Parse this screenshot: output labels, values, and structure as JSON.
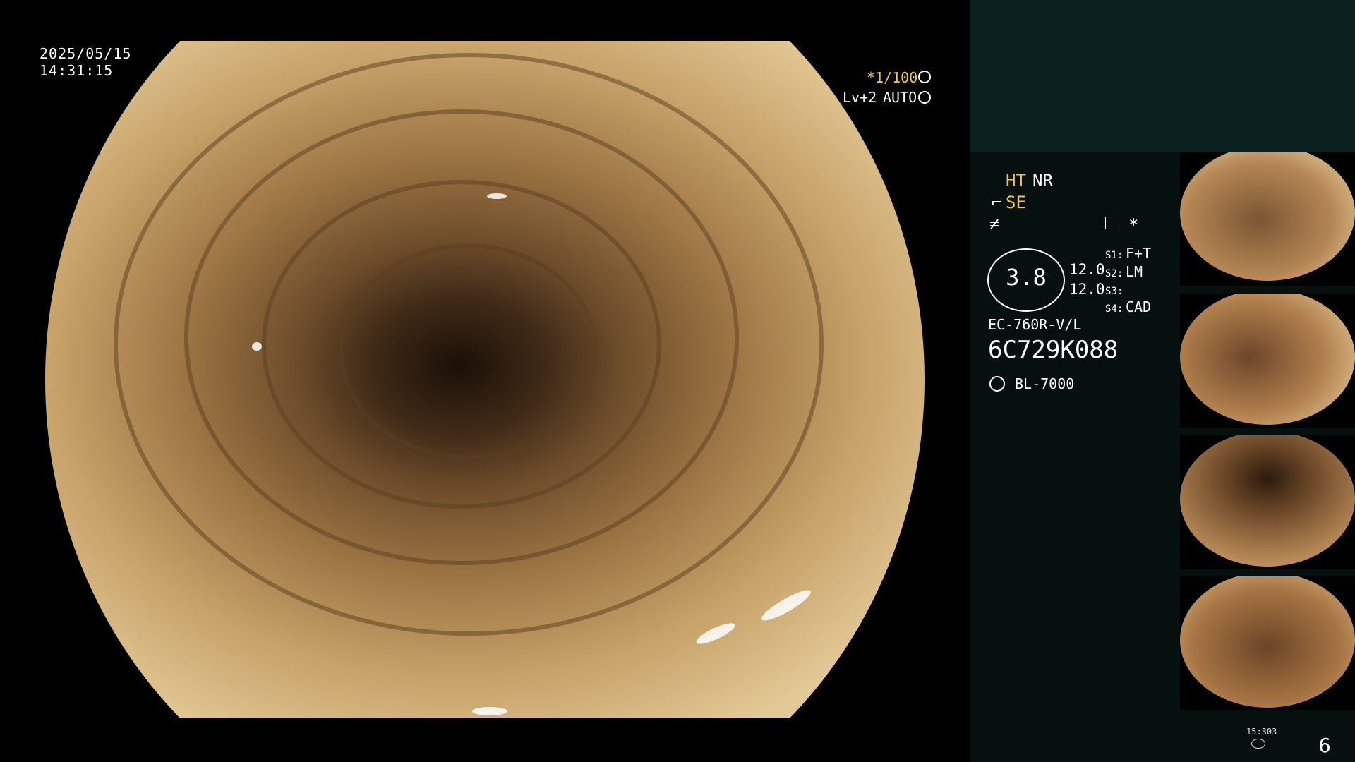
{
  "overlay": {
    "date": "2025/05/15",
    "time": "14:31:15",
    "shutter": "*1/100",
    "light_level": "Lv+2",
    "mode": "AUTO"
  },
  "settings": {
    "ht": "HT",
    "nr": "NR",
    "se": "SE",
    "gauge_value": "3.8",
    "value_1": "12.0",
    "value_2": "12.0",
    "s1_label": "S1:",
    "s1_value": "F+T",
    "s2_label": "S2:",
    "s2_value": "LM",
    "s3_label": "S3:",
    "s3_value": "",
    "s4_label": "S4:",
    "s4_value": "CAD",
    "scope_model": "EC-760R-V/L",
    "serial": "6C729K088",
    "light_source": "BL-7000"
  },
  "status": {
    "time": "15:303",
    "count": "6"
  },
  "colors": {
    "accent_yellow": "#f3c63c",
    "panel_bg": "#06100e",
    "panel_top_bg": "#0b211f"
  },
  "icons": [
    "aperture-icon",
    "auto-iris-icon",
    "structure-enhance-icon",
    "color-icon",
    "freeze-icon",
    "asterisk-icon",
    "brightness-icon",
    "light-icon",
    "storage-icon"
  ]
}
